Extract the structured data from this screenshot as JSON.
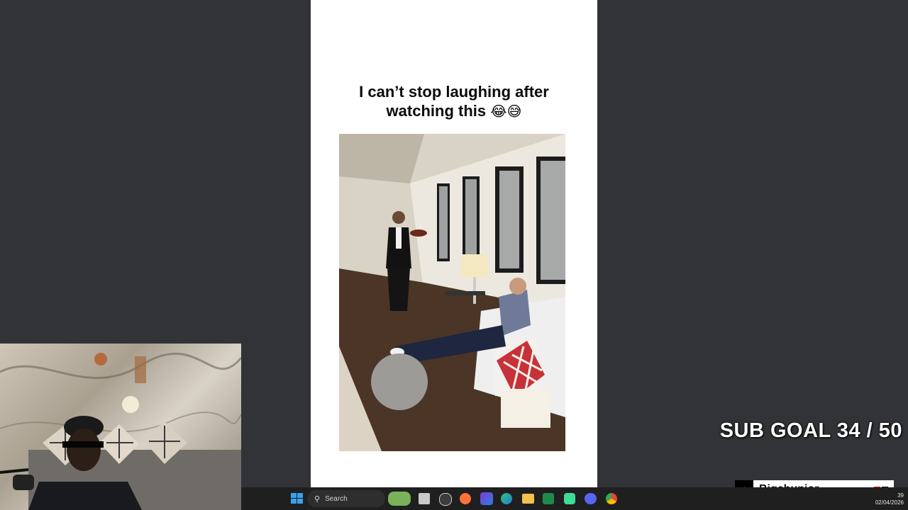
{
  "post": {
    "title_line1": "I can’t stop laughing after",
    "title_line2": "watching this",
    "title_emoji": "😂😅"
  },
  "overlay": {
    "sub_goal": "SUB GOAL 34 / 50"
  },
  "tiktok": {
    "username": "Bigchunior",
    "logo_glyph": "♪"
  },
  "taskbar": {
    "search_placeholder": "Search",
    "date": "02/04/2026",
    "time_fragment": "39",
    "icons": [
      "windows-start-icon",
      "search-icon",
      "widgets-icon",
      "file-manager-icon",
      "obs-icon",
      "firefox-icon",
      "game-launcher-icon",
      "edge-icon",
      "folder-icon",
      "excel-icon",
      "app-icon",
      "discord-icon",
      "chrome-icon"
    ]
  },
  "colors": {
    "background": "#323336",
    "panel": "#ffffff",
    "taskbar": "#1f1f1f",
    "tiktok_red": "#e01c24"
  }
}
